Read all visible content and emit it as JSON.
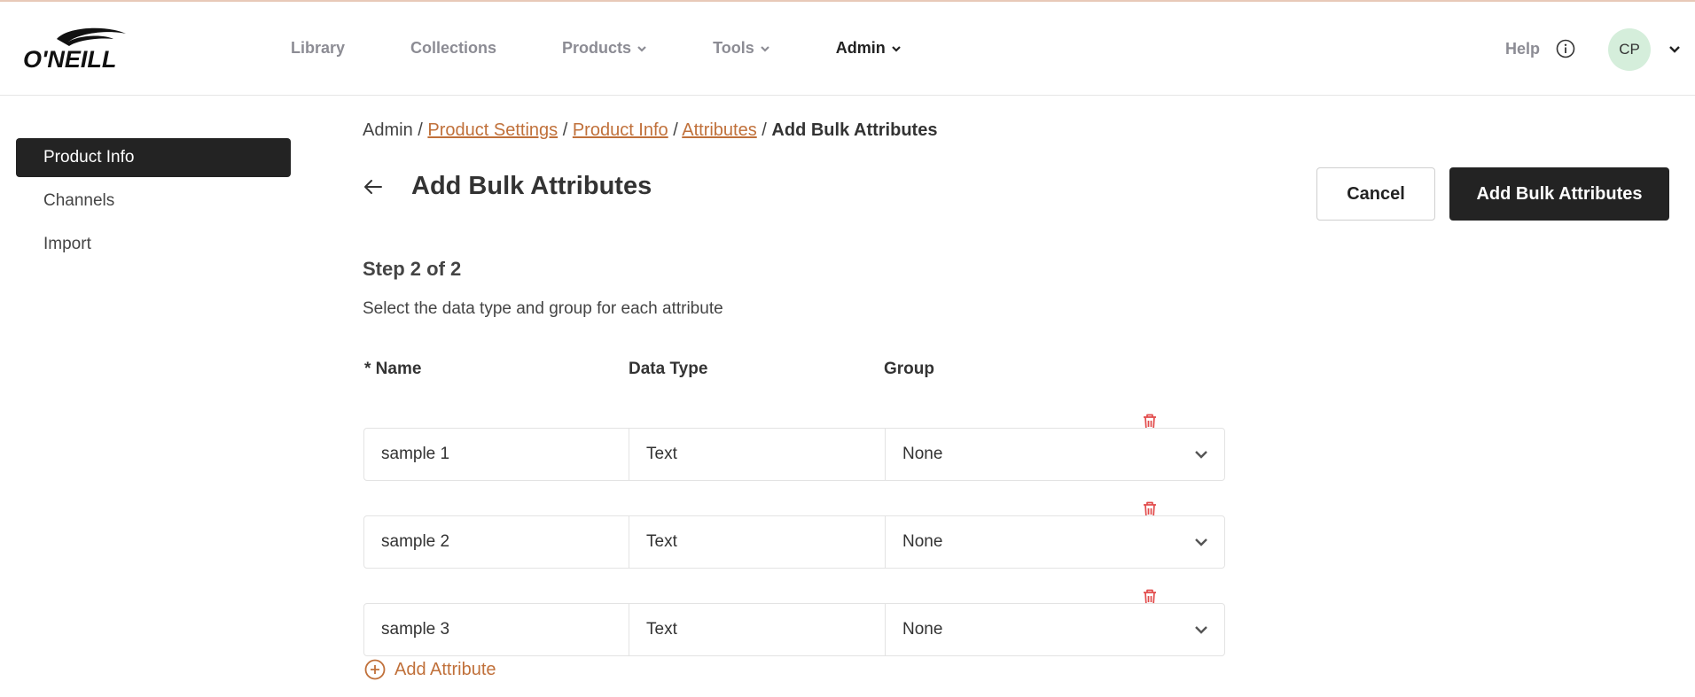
{
  "brand": {
    "logo_text": "O'NEILL"
  },
  "nav": {
    "items": [
      {
        "label": "Library",
        "has_menu": false,
        "active": false
      },
      {
        "label": "Collections",
        "has_menu": false,
        "active": false
      },
      {
        "label": "Products",
        "has_menu": true,
        "active": false
      },
      {
        "label": "Tools",
        "has_menu": true,
        "active": false
      },
      {
        "label": "Admin",
        "has_menu": true,
        "active": true
      }
    ],
    "help_label": "Help",
    "avatar_initials": "CP"
  },
  "sidebar": {
    "items": [
      {
        "label": "Product Info",
        "active": true
      },
      {
        "label": "Channels",
        "active": false
      },
      {
        "label": "Import",
        "active": false
      }
    ]
  },
  "breadcrumb": {
    "root": "Admin",
    "links": [
      "Product Settings",
      "Product Info",
      "Attributes"
    ],
    "current": "Add Bulk Attributes",
    "separator": "/"
  },
  "page": {
    "title": "Add Bulk Attributes",
    "cancel_label": "Cancel",
    "submit_label": "Add Bulk Attributes",
    "step": "Step 2 of 2",
    "description": "Select the data type and group for each attribute"
  },
  "table": {
    "headers": {
      "name": "* Name",
      "type": "Data Type",
      "group": "Group"
    },
    "rows": [
      {
        "name": "sample 1",
        "type": "Text",
        "group": "None"
      },
      {
        "name": "sample 2",
        "type": "Text",
        "group": "None"
      },
      {
        "name": "sample 3",
        "type": "Text",
        "group": "None"
      }
    ],
    "add_label": "Add Attribute"
  },
  "icons": {
    "back": "arrow-left-icon",
    "delete": "trash-icon",
    "add": "plus-circle-icon",
    "dropdown": "chevron-down-icon",
    "help": "info-icon"
  },
  "colors": {
    "accent": "#c0703a",
    "dark": "#232323",
    "danger": "#e24b4b",
    "avatar_bg": "#d5eedb"
  }
}
